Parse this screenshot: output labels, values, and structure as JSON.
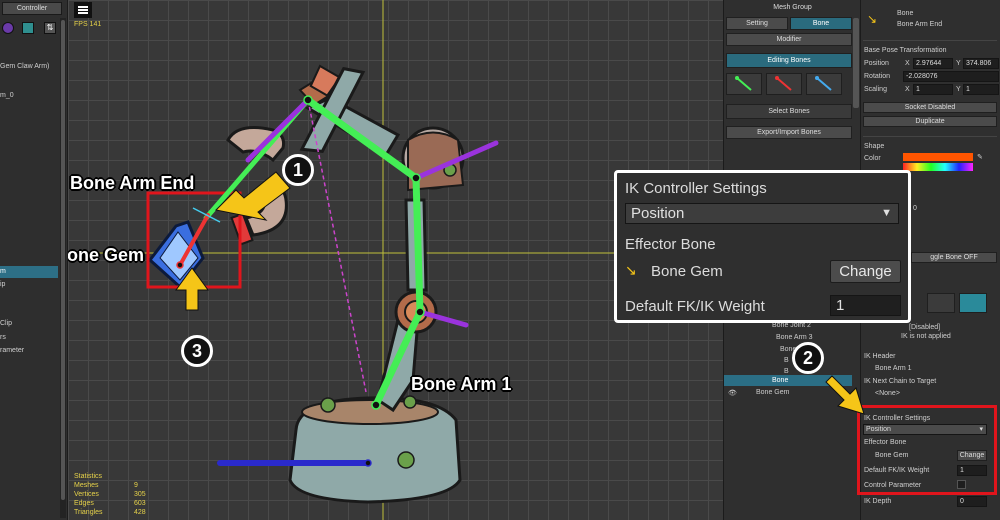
{
  "left_panel": {
    "tab": "Controller",
    "items": [
      "Gem Claw Arm)",
      "m_0",
      "m",
      "ip",
      "Clip",
      "rs",
      "rameter"
    ]
  },
  "viewport": {
    "fps": "FPS 141",
    "labels": {
      "bone_arm_end": "Bone Arm End",
      "bone_gem": "Bone Gem",
      "bone_arm_1": "Bone Arm 1"
    },
    "badges": [
      "1",
      "2",
      "3"
    ],
    "statistics": {
      "title": "Statistics",
      "rows": [
        {
          "key": "Meshes",
          "value": "9"
        },
        {
          "key": "Vertices",
          "value": "305"
        },
        {
          "key": "Edges",
          "value": "603"
        },
        {
          "key": "Triangles",
          "value": "428"
        },
        {
          "key": "Bones",
          "value": "11"
        }
      ]
    }
  },
  "middle_panel": {
    "title": "Mesh Group",
    "tab_setting": "Setting",
    "tab_bone": "Bone",
    "modifier": "Modifier",
    "editing_bones": "Editing Bones",
    "select_bones": "Select Bones",
    "export_import": "Export/Import Bones",
    "tree": [
      "Bone Joint 2",
      "Bone Arm 3",
      "Bone",
      "B",
      "B",
      "Bone",
      "Bone Gem"
    ]
  },
  "right_panel": {
    "bone_header": "Bone",
    "bone_name": "Bone Arm End",
    "base_pose": "Base Pose Transformation",
    "position_label": "Position",
    "x_label": "X",
    "y_label": "Y",
    "position_x": "2.97644",
    "position_y": "374.806",
    "rotation_label": "Rotation",
    "rotation": "-2.028076",
    "scaling_label": "Scaling",
    "scale_x": "1",
    "scale_y": "1",
    "socket": "Socket Disabled",
    "duplicate": "Duplicate",
    "shape": "Shape",
    "color": "Color",
    "partial_0": "0",
    "toggle_partial": "ggle Bone OFF",
    "disabled": "[Disabled]",
    "ik_not_applied": "IK is not applied",
    "ik_header": "IK Header",
    "ik_header_value": "Bone Arm 1",
    "ik_next": "IK Next Chain to Target",
    "ik_next_value": "<None>",
    "ik_settings": "IK Controller Settings",
    "ik_mode": "Position",
    "effector": "Effector Bone",
    "effector_value": "Bone Gem",
    "change": "Change",
    "weight_label": "Default FK/IK Weight",
    "weight_value": "1",
    "control_param": "Control Parameter",
    "ik_depth": "IK Depth",
    "ik_depth_value": "0"
  },
  "popup": {
    "title": "IK Controller Settings",
    "mode": "Position",
    "effector_label": "Effector Bone",
    "effector_value": "Bone Gem",
    "change": "Change",
    "weight_label": "Default FK/IK Weight",
    "weight_value": "1"
  },
  "colors": {
    "accent": "#2a6b7e",
    "highlight_red": "#e0151c",
    "arrow_yellow": "#f5c518",
    "bone_green": "#44ee55",
    "bone_purple": "#9a33dd"
  }
}
